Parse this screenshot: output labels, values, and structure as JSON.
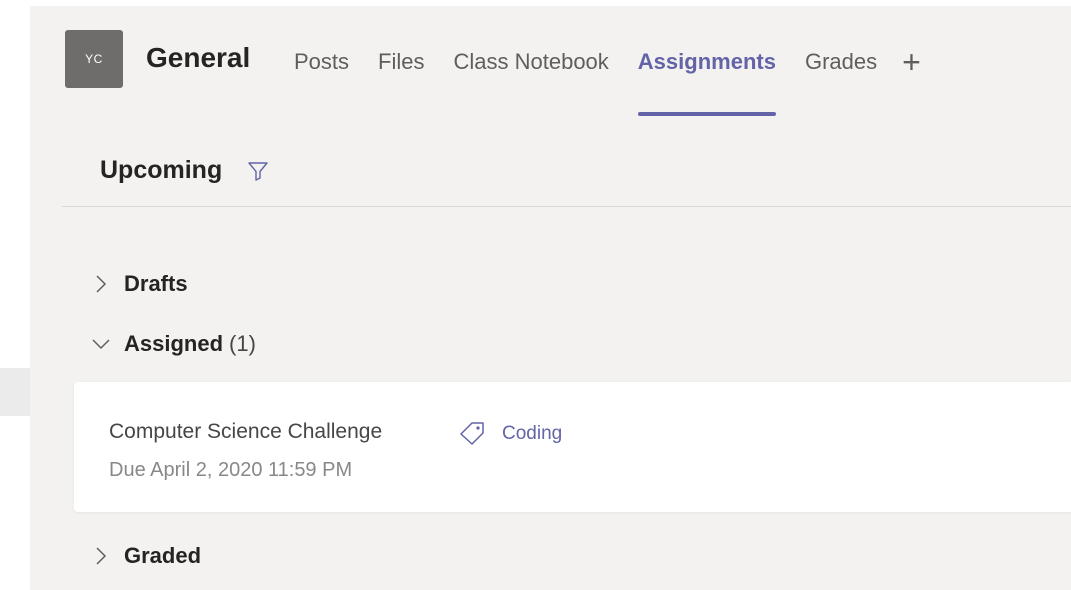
{
  "header": {
    "avatar_initials": "YC",
    "team_name": "General",
    "tabs": [
      {
        "label": "Posts"
      },
      {
        "label": "Files"
      },
      {
        "label": "Class Notebook"
      },
      {
        "label": "Assignments",
        "active": true
      },
      {
        "label": "Grades"
      }
    ],
    "add_tab_symbol": "+"
  },
  "filter_bar": {
    "label": "Upcoming",
    "icon": "filter-icon"
  },
  "groups": {
    "drafts": {
      "label": "Drafts",
      "expanded": false
    },
    "assigned": {
      "label": "Assigned",
      "count": "(1)",
      "expanded": true
    },
    "graded": {
      "label": "Graded",
      "expanded": false
    }
  },
  "assignment": {
    "title": "Computer Science Challenge",
    "tag_icon": "tag-icon",
    "tag": "Coding",
    "due": "Due April 2, 2020 11:59 PM"
  },
  "colors": {
    "accent": "#6264a7",
    "background": "#f3f2f1",
    "card": "#ffffff",
    "avatar": "#6e6d6c"
  }
}
